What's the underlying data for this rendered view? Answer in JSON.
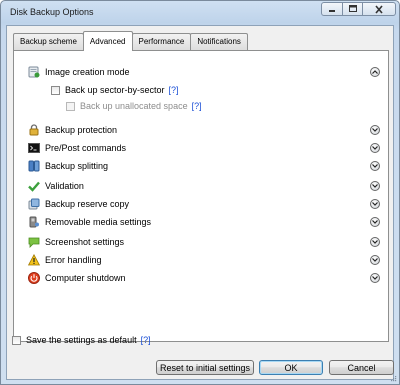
{
  "window": {
    "title": "Disk Backup Options"
  },
  "tabs": [
    {
      "label": "Backup scheme",
      "active": false
    },
    {
      "label": "Advanced",
      "active": true
    },
    {
      "label": "Performance",
      "active": false
    },
    {
      "label": "Notifications",
      "active": false
    }
  ],
  "sections": [
    {
      "label": "Image creation mode",
      "icon": "disk-image-icon",
      "expanded": true
    },
    {
      "label": "Backup protection",
      "icon": "padlock-icon",
      "expanded": false
    },
    {
      "label": "Pre/Post commands",
      "icon": "command-prompt-icon",
      "expanded": false
    },
    {
      "label": "Backup splitting",
      "icon": "split-icon",
      "expanded": false
    },
    {
      "label": "Validation",
      "icon": "checkmark-icon",
      "expanded": false
    },
    {
      "label": "Backup reserve copy",
      "icon": "reserve-copy-icon",
      "expanded": false
    },
    {
      "label": "Removable media settings",
      "icon": "removable-media-icon",
      "expanded": false
    },
    {
      "label": "Screenshot settings",
      "icon": "speech-bubble-icon",
      "expanded": false
    },
    {
      "label": "Error handling",
      "icon": "warning-icon",
      "expanded": false
    },
    {
      "label": "Computer shutdown",
      "icon": "power-icon",
      "expanded": false
    }
  ],
  "image_creation": {
    "sector_by_sector": {
      "label": "Back up sector-by-sector",
      "help": "[?]",
      "checked": false
    },
    "unallocated": {
      "label": "Back up unallocated space",
      "help": "[?]",
      "checked": false,
      "disabled": true
    }
  },
  "footer": {
    "save_default": {
      "label": "Save the settings as default",
      "help": "[?]",
      "checked": false
    },
    "reset_button": "Reset to initial settings",
    "ok_button": "OK",
    "cancel_button": "Cancel"
  },
  "colors": {
    "help_link": "#1a4fd6",
    "window_frame": "#bed3ea",
    "disabled_text": "#8d8d8d"
  }
}
